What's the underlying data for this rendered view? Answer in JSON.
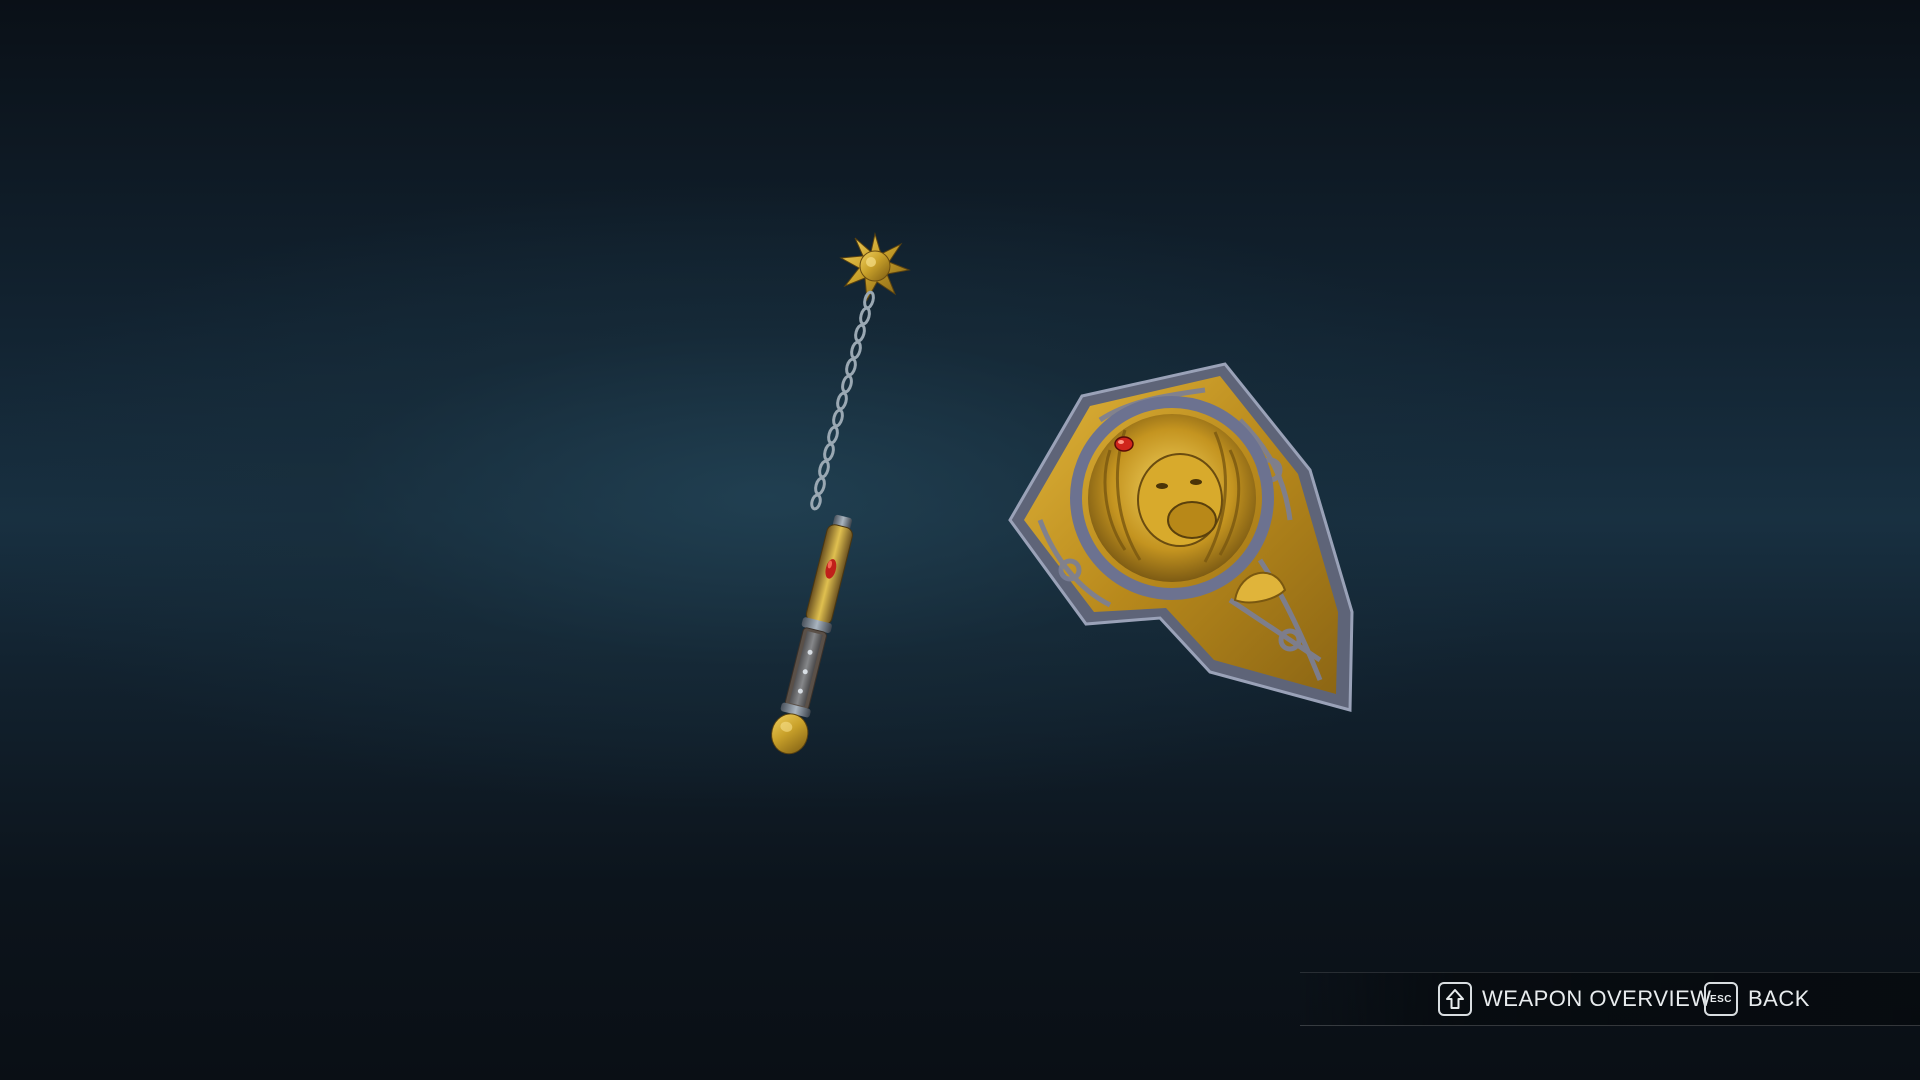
{
  "scene": {
    "items": [
      {
        "name": "flail",
        "colors": {
          "gold": "#c9a12a",
          "chain": "#8a98a4",
          "jewel": "#c0201a"
        }
      },
      {
        "name": "lion-shield",
        "colors": {
          "gold": "#c89a22",
          "trim": "#6f7690",
          "jewel": "#d0251c"
        }
      }
    ]
  },
  "footer": {
    "weapon_overview": {
      "key_icon": "shift-key-icon",
      "label": "WEAPON OVERVIEW"
    },
    "back": {
      "key": "ESC",
      "label": "BACK"
    }
  },
  "colors": {
    "background_dark": "#0a1017",
    "background_mid": "#183041",
    "text": "#e8ecee"
  }
}
